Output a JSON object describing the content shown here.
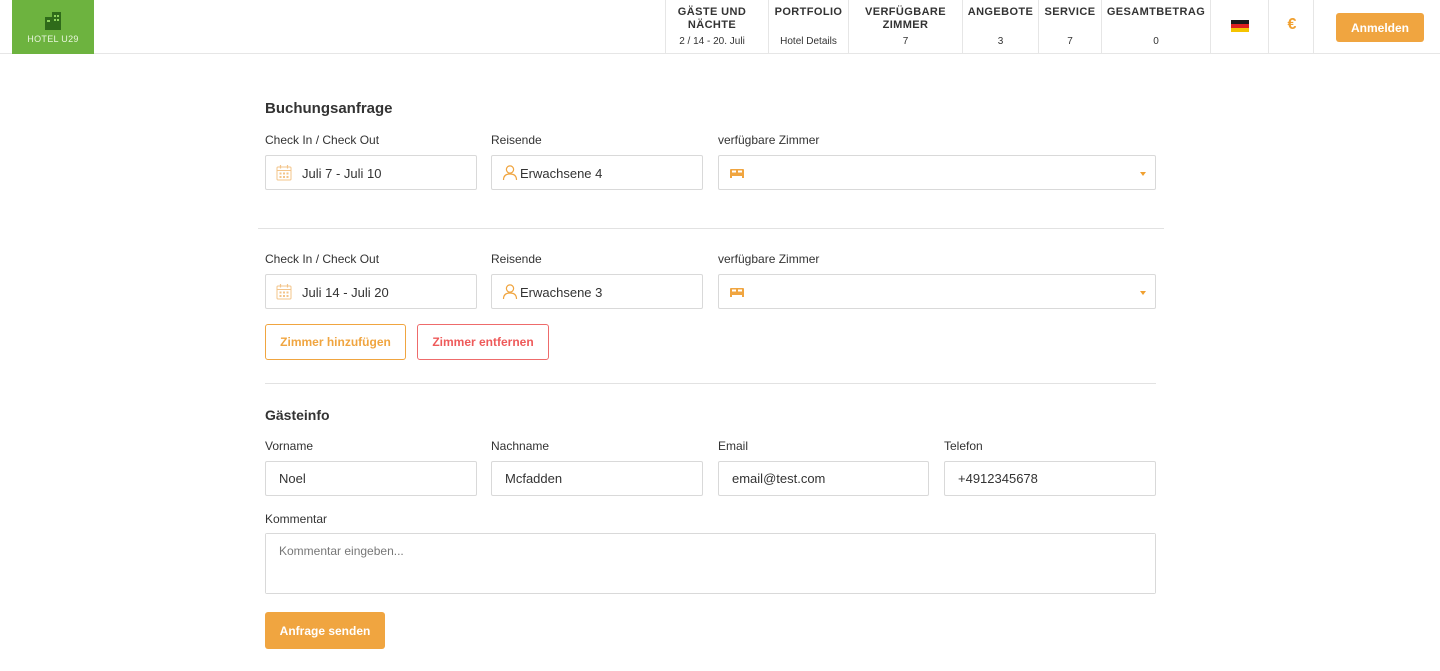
{
  "header": {
    "logo_text": "HOTEL U29",
    "nav": [
      {
        "title": "GÄSTE UND NÄCHTE",
        "value": "2 / 14 - 20. Juli"
      },
      {
        "title": "PORTFOLIO",
        "value": "Hotel Details"
      },
      {
        "title": "VERFÜGBARE ZIMMER",
        "value": "7"
      },
      {
        "title": "ANGEBOTE",
        "value": "3"
      },
      {
        "title": "SERVICE",
        "value": "7"
      },
      {
        "title": "GESAMTBETRAG",
        "value": "0"
      }
    ],
    "language_flag": "flag-germany-icon",
    "currency_symbol": "€",
    "login_label": "Anmelden"
  },
  "booking": {
    "title": "Buchungsanfrage",
    "rooms": [
      {
        "dates_label": "Check In / Check Out",
        "dates_value": "Juli 7 - Juli 10",
        "guests_label": "Reisende",
        "guests_value": "Erwachsene  4",
        "room_label": "verfügbare Zimmer",
        "room_value": ""
      },
      {
        "dates_label": "Check In / Check Out",
        "dates_value": "Juli 14 - Juli 20",
        "guests_label": "Reisende",
        "guests_value": "Erwachsene 3",
        "room_label": "verfügbare Zimmer",
        "room_value": ""
      }
    ],
    "add_room_label": "Zimmer hinzufügen",
    "remove_room_label": "Zimmer entfernen"
  },
  "guest": {
    "title": "Gästeinfo",
    "first_name_label": "Vorname",
    "first_name_value": "Noel",
    "last_name_label": "Nachname",
    "last_name_value": "Mcfadden",
    "email_label": "Email",
    "email_value": "email@test.com",
    "phone_label": "Telefon",
    "phone_value": "+4912345678",
    "comment_label": "Kommentar",
    "comment_placeholder": "Kommentar eingeben...",
    "submit_label": "Anfrage senden"
  },
  "colors": {
    "accent": "#f0a540",
    "danger": "#ee5a5a",
    "logo_green": "#6db33f"
  }
}
